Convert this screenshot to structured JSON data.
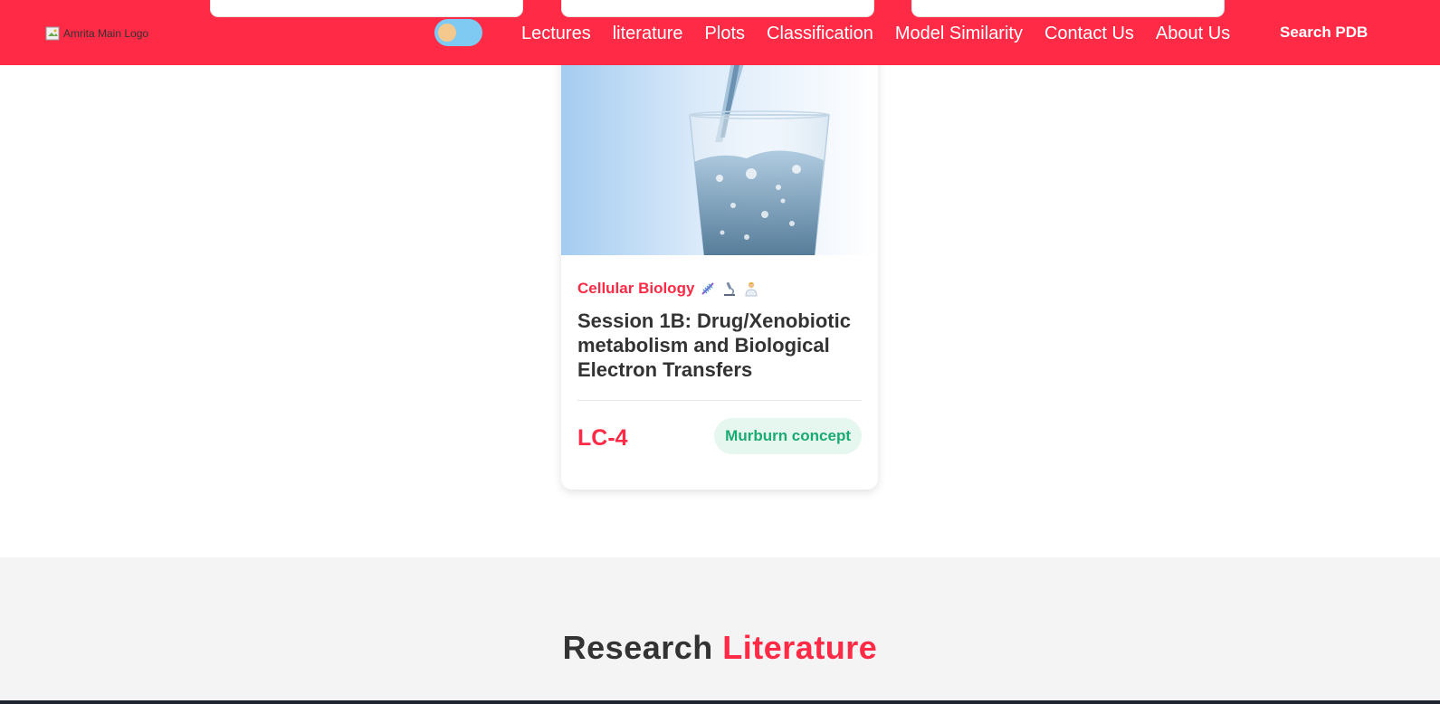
{
  "header": {
    "logo_alt": "Amrita Main Logo",
    "nav": [
      {
        "label": "Lectures"
      },
      {
        "label": "literature"
      },
      {
        "label": "Plots"
      },
      {
        "label": "Classification"
      },
      {
        "label": "Model Similarity"
      },
      {
        "label": "Contact Us"
      },
      {
        "label": "About Us"
      }
    ],
    "search_label": "Search PDB"
  },
  "card": {
    "category": "Cellular Biology",
    "category_icons": [
      "dna-icon",
      "microscope-icon",
      "scientist-icon"
    ],
    "title": "Session 1B: Drug/Xenobiotic metabolism and Biological Electron Transfers",
    "code": "LC-4",
    "badge": "Murburn concept"
  },
  "research": {
    "heading_part1": "Research",
    "heading_part2": "Literature"
  },
  "colors": {
    "brand": "#ff2a45",
    "badge_bg": "#e6f7f0",
    "badge_text": "#1aaa72",
    "toggle": "#7fcaf2"
  }
}
